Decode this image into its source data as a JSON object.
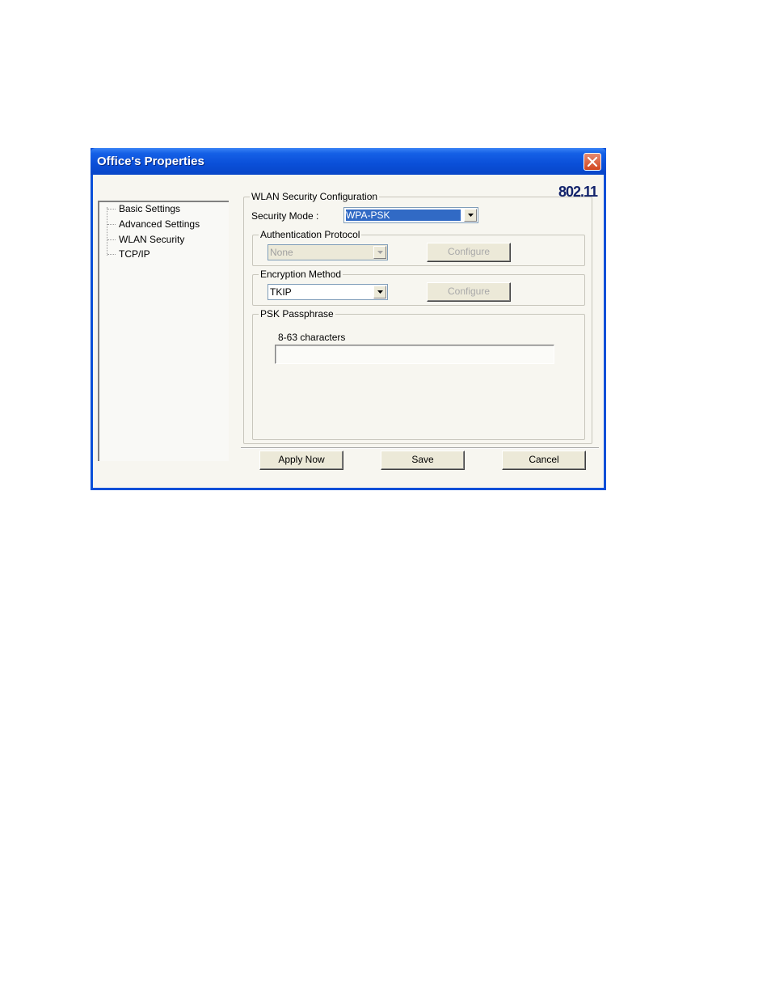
{
  "window": {
    "title": "Office's Properties",
    "brand": "802.11"
  },
  "tree": {
    "items": [
      {
        "label": "Basic Settings"
      },
      {
        "label": "Advanced Settings"
      },
      {
        "label": "WLAN Security"
      },
      {
        "label": "TCP/IP"
      }
    ]
  },
  "wlan": {
    "group_label": "WLAN Security Configuration",
    "security_mode_label": "Security Mode :",
    "security_mode_value": "WPA-PSK",
    "auth": {
      "group_label": "Authentication Protocol",
      "value": "None",
      "configure_label": "Configure"
    },
    "encryption": {
      "group_label": "Encryption Method",
      "value": "TKIP",
      "configure_label": "Configure"
    },
    "psk": {
      "group_label": "PSK Passphrase",
      "hint": "8-63 characters",
      "value": ""
    }
  },
  "buttons": {
    "apply": "Apply Now",
    "save": "Save",
    "cancel": "Cancel"
  },
  "colors": {
    "title_bar": "#0a4fd8",
    "selection": "#316ac5",
    "brand_text": "#13236b"
  }
}
